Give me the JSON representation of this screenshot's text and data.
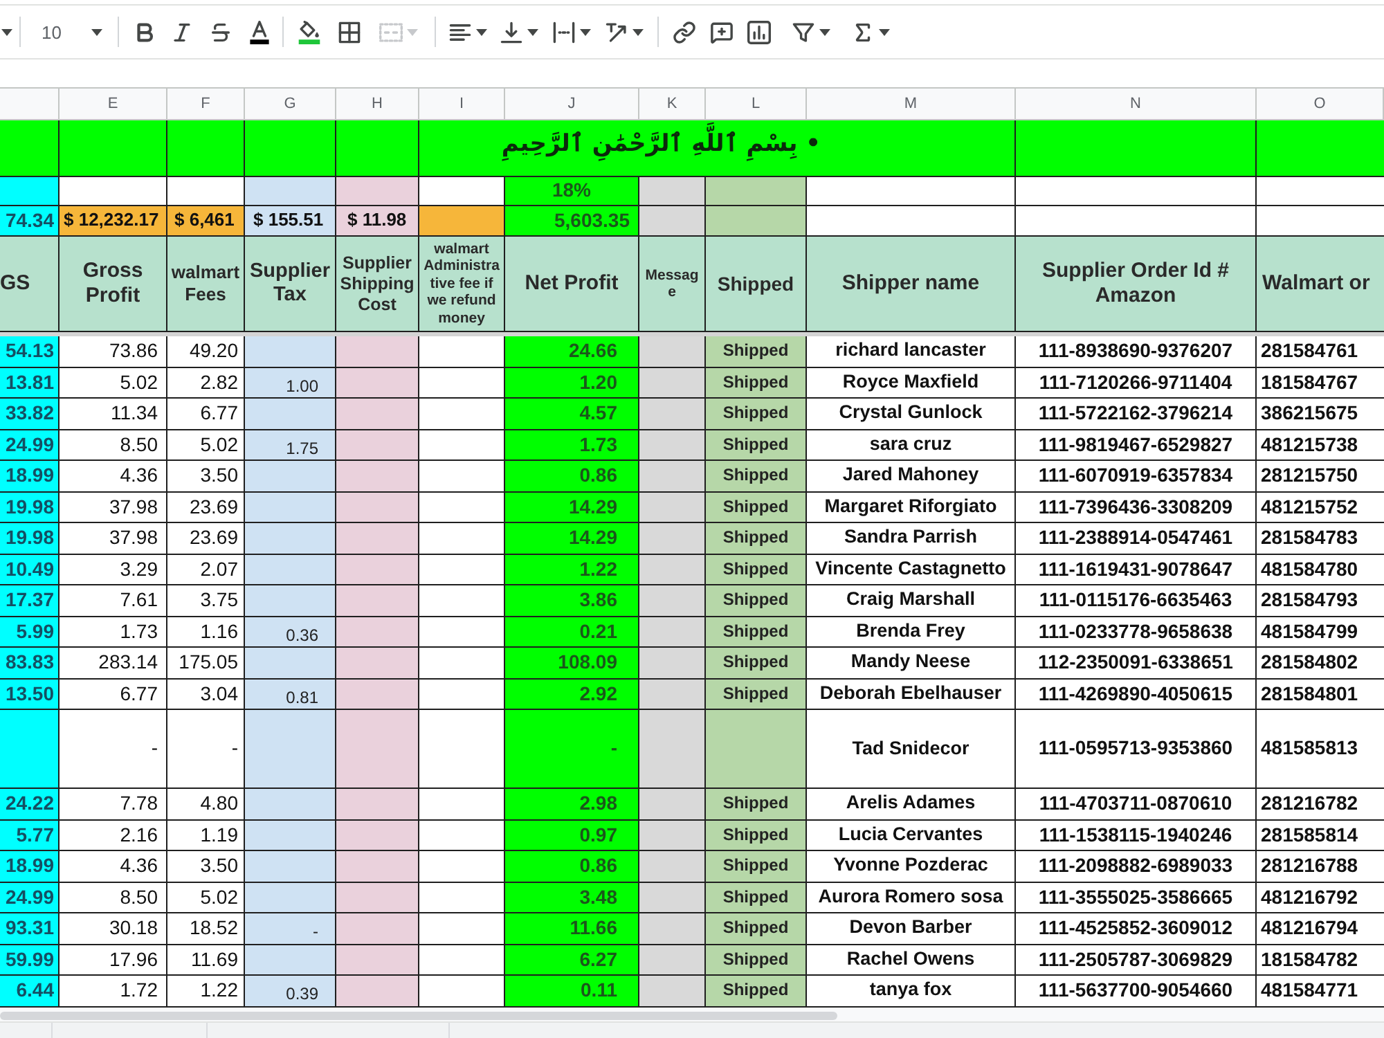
{
  "toolbar": {
    "font_size": "10",
    "merge_button": {
      "disabled": true
    }
  },
  "sheet": {
    "column_letters": [
      "E",
      "F",
      "G",
      "H",
      "I",
      "J",
      "K",
      "L",
      "M",
      "N",
      "O"
    ],
    "banner": "• بِسْمِ ٱللَّهِ ٱلرَّحْمَٰنِ ٱلرَّحِيمِ",
    "rate_row": {
      "net_profit": "18%"
    },
    "totals_row": {
      "column_d": "74.34",
      "gross_profit": "$ 12,232.17",
      "walmart_fees": "$ 6,461",
      "supplier_tax": "$ 155.51",
      "supplier_shipping_cost": "$ 11.98",
      "net_profit": "5,603.35"
    },
    "headers": {
      "column_d": "GS",
      "gross_profit": "Gross Profit",
      "walmart_fees": "walmart Fees",
      "supplier_tax": "Supplier Tax",
      "supplier_shipping_cost": "Supplier Shipping Cost",
      "walmart_admin_fee": "walmart Administrative fee if we refund money",
      "net_profit": "Net Profit",
      "message": "Message",
      "shipped": "Shipped",
      "shipper_name": "Shipper name",
      "supplier_order_id": "Supplier Order Id # Amazon",
      "column_o": "Walmart or"
    },
    "rows": [
      {
        "tall": false,
        "column_d": "54.13",
        "gross_profit": "73.86",
        "walmart_fees": "49.20",
        "net_profit": "24.66",
        "shipped": "Shipped",
        "shipper_name": "richard lancaster",
        "supplier_order_id": "111-8938690-9376207",
        "column_o": "281584761"
      },
      {
        "tall": false,
        "column_d": "13.81",
        "gross_profit": "5.02",
        "walmart_fees": "2.82",
        "supplier_tax": "1.00",
        "net_profit": "1.20",
        "shipped": "Shipped",
        "shipper_name": "Royce Maxfield",
        "supplier_order_id": "111-7120266-9711404",
        "column_o": "181584767"
      },
      {
        "tall": false,
        "column_d": "33.82",
        "gross_profit": "11.34",
        "walmart_fees": "6.77",
        "net_profit": "4.57",
        "shipped": "Shipped",
        "shipper_name": "Crystal Gunlock",
        "supplier_order_id": "111-5722162-3796214",
        "column_o": "386215675"
      },
      {
        "tall": false,
        "column_d": "24.99",
        "gross_profit": "8.50",
        "walmart_fees": "5.02",
        "supplier_tax": "1.75",
        "net_profit": "1.73",
        "shipped": "Shipped",
        "shipper_name": "sara cruz",
        "supplier_order_id": "111-9819467-6529827",
        "column_o": "481215738"
      },
      {
        "tall": false,
        "column_d": "18.99",
        "gross_profit": "4.36",
        "walmart_fees": "3.50",
        "net_profit": "0.86",
        "shipped": "Shipped",
        "shipper_name": "Jared Mahoney",
        "supplier_order_id": "111-6070919-6357834",
        "column_o": "281215750"
      },
      {
        "tall": false,
        "column_d": "19.98",
        "gross_profit": "37.98",
        "walmart_fees": "23.69",
        "net_profit": "14.29",
        "shipped": "Shipped",
        "shipper_name": "Margaret Riforgiato",
        "supplier_order_id": "111-7396436-3308209",
        "column_o": "481215752"
      },
      {
        "tall": false,
        "column_d": "19.98",
        "gross_profit": "37.98",
        "walmart_fees": "23.69",
        "net_profit": "14.29",
        "shipped": "Shipped",
        "shipper_name": "Sandra Parrish",
        "supplier_order_id": "111-2388914-0547461",
        "column_o": "281584783"
      },
      {
        "tall": false,
        "column_d": "10.49",
        "gross_profit": "3.29",
        "walmart_fees": "2.07",
        "net_profit": "1.22",
        "shipped": "Shipped",
        "shipper_name": "Vincente Castagnetto",
        "supplier_order_id": "111-1619431-9078647",
        "column_o": "481584780"
      },
      {
        "tall": false,
        "column_d": "17.37",
        "gross_profit": "7.61",
        "walmart_fees": "3.75",
        "net_profit": "3.86",
        "shipped": "Shipped",
        "shipper_name": "Craig Marshall",
        "supplier_order_id": "111-0115176-6635463",
        "column_o": "281584793"
      },
      {
        "tall": false,
        "column_d": "5.99",
        "gross_profit": "1.73",
        "walmart_fees": "1.16",
        "supplier_tax": "0.36",
        "net_profit": "0.21",
        "shipped": "Shipped",
        "shipper_name": "Brenda Frey",
        "supplier_order_id": "111-0233778-9658638",
        "column_o": "481584799"
      },
      {
        "tall": false,
        "column_d": "83.83",
        "gross_profit": "283.14",
        "walmart_fees": "175.05",
        "net_profit": "108.09",
        "shipped": "Shipped",
        "shipper_name": "Mandy Neese",
        "supplier_order_id": "112-2350091-6338651",
        "column_o": "281584802"
      },
      {
        "tall": false,
        "column_d": "13.50",
        "gross_profit": "6.77",
        "walmart_fees": "3.04",
        "supplier_tax": "0.81",
        "net_profit": "2.92",
        "shipped": "Shipped",
        "shipper_name": "Deborah Ebelhauser",
        "supplier_order_id": "111-4269890-4050615",
        "column_o": "281584801"
      },
      {
        "tall": true,
        "gross_profit": "-",
        "walmart_fees": "-",
        "net_profit": "-",
        "shipper_name": "Tad Snidecor",
        "supplier_order_id": "111-0595713-9353860",
        "column_o": "481585813"
      },
      {
        "tall": false,
        "column_d": "24.22",
        "gross_profit": "7.78",
        "walmart_fees": "4.80",
        "net_profit": "2.98",
        "shipped": "Shipped",
        "shipper_name": "Arelis Adames",
        "supplier_order_id": "111-4703711-0870610",
        "column_o": "281216782"
      },
      {
        "tall": false,
        "column_d": "5.77",
        "gross_profit": "2.16",
        "walmart_fees": "1.19",
        "net_profit": "0.97",
        "shipped": "Shipped",
        "shipper_name": "Lucia Cervantes",
        "supplier_order_id": "111-1538115-1940246",
        "column_o": "281585814"
      },
      {
        "tall": false,
        "column_d": "18.99",
        "gross_profit": "4.36",
        "walmart_fees": "3.50",
        "net_profit": "0.86",
        "shipped": "Shipped",
        "shipper_name": "Yvonne Pozderac",
        "supplier_order_id": "111-2098882-6989033",
        "column_o": "281216788"
      },
      {
        "tall": false,
        "column_d": "24.99",
        "gross_profit": "8.50",
        "walmart_fees": "5.02",
        "net_profit": "3.48",
        "shipped": "Shipped",
        "shipper_name": "Aurora Romero sosa",
        "supplier_order_id": "111-3555025-3586665",
        "column_o": "481216792"
      },
      {
        "tall": false,
        "column_d": "93.31",
        "gross_profit": "30.18",
        "walmart_fees": "18.52",
        "supplier_tax": "-",
        "net_profit": "11.66",
        "shipped": "Shipped",
        "shipper_name": "Devon Barber",
        "supplier_order_id": "111-4525852-3609012",
        "column_o": "481216794"
      },
      {
        "tall": false,
        "column_d": "59.99",
        "gross_profit": "17.96",
        "walmart_fees": "11.69",
        "net_profit": "6.27",
        "shipped": "Shipped",
        "shipper_name": "Rachel Owens",
        "supplier_order_id": "111-2505787-3069829",
        "column_o": "181584782"
      },
      {
        "tall": false,
        "column_d": "6.44",
        "gross_profit": "1.72",
        "walmart_fees": "1.22",
        "supplier_tax": "0.39",
        "net_profit": "0.11",
        "shipped": "Shipped",
        "shipper_name": "tanya fox",
        "supplier_order_id": "111-5637700-9054660",
        "column_o": "481584771"
      }
    ]
  }
}
